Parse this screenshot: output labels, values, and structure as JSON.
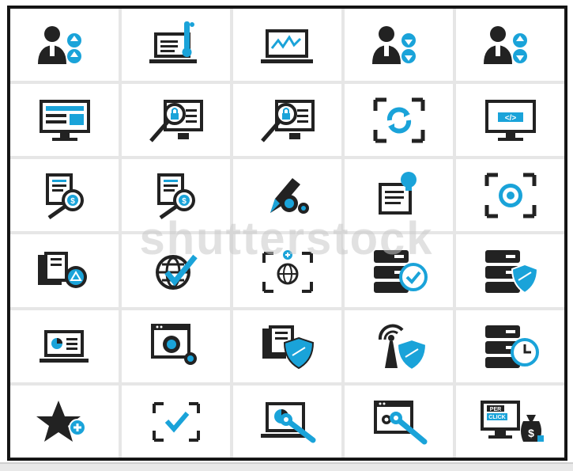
{
  "watermark": "shutterstock",
  "colors": {
    "dark": "#222222",
    "accent": "#1aa3d9",
    "cell_bg": "#ffffff"
  },
  "icons": [
    [
      "user-upload-icon",
      "laptop-thermometer-icon",
      "laptop-analytics-icon",
      "user-download-icon",
      "user-download-icon"
    ],
    [
      "monitor-dashboard-icon",
      "monitor-security-search-icon",
      "monitor-security-search-icon",
      "screen-refresh-icon",
      "monitor-code-icon"
    ],
    [
      "document-money-search-icon",
      "document-money-search-icon",
      "pencil-gear-icon",
      "document-idea-icon",
      "target-focus-icon"
    ],
    [
      "documents-recycle-icon",
      "globe-check-icon",
      "globe-focus-icon",
      "server-check-icon",
      "server-shield-icon"
    ],
    [
      "laptop-chart-icon",
      "browser-gear-icon",
      "documents-shield-icon",
      "antenna-shield-icon",
      "server-clock-icon"
    ],
    [
      "star-add-icon",
      "focus-check-icon",
      "laptop-wrench-icon",
      "browser-wrench-icon",
      "pay-per-click-icon"
    ]
  ],
  "labels": {
    "per": "PER",
    "click": "CLICK",
    "code": "</>",
    "dollar": "$"
  }
}
